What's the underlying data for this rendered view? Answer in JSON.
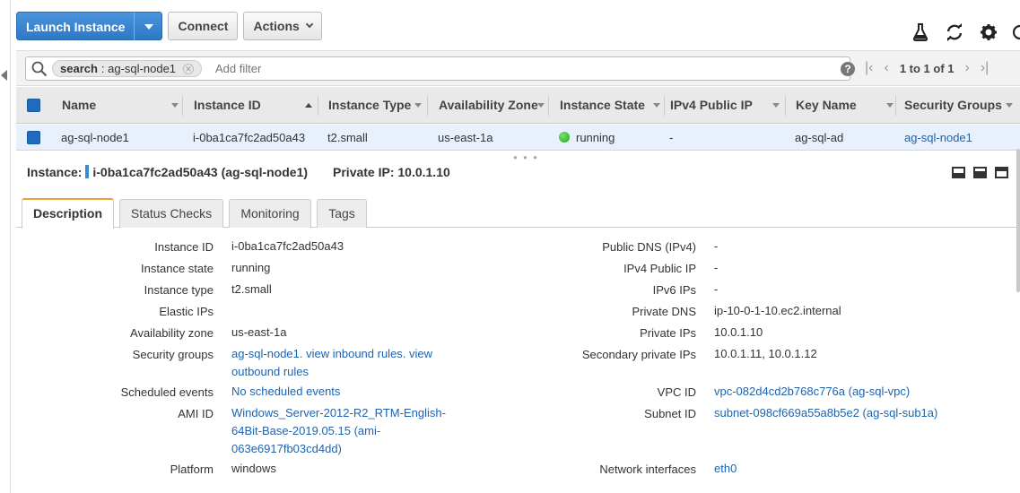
{
  "toolbar": {
    "launch_label": "Launch Instance",
    "connect_label": "Connect",
    "actions_label": "Actions"
  },
  "icons": {
    "flask": "flask-icon",
    "refresh": "refresh-icon",
    "settings": "gear-icon",
    "help": "help-icon"
  },
  "filter": {
    "chip_key": "search",
    "chip_value": ": ag-sql-node1",
    "placeholder": "Add filter",
    "help_label": "?"
  },
  "pager": {
    "count_text": "1 to 1 of 1"
  },
  "table": {
    "headers": [
      "Name",
      "Instance ID",
      "Instance Type",
      "Availability Zone",
      "Instance State",
      "IPv4 Public IP",
      "Key Name",
      "Security Groups"
    ],
    "rows": [
      {
        "name": "ag-sql-node1",
        "instance_id": "i-0ba1ca7fc2ad50a43",
        "instance_type": "t2.small",
        "availability_zone": "us-east-1a",
        "instance_state": "running",
        "ipv4_public_ip": "-",
        "key_name": "ag-sql-ad",
        "security_groups": "ag-sql-node1"
      }
    ]
  },
  "detail": {
    "instance_prefix": "Instance:",
    "instance_text": "i-0ba1ca7fc2ad50a43 (ag-sql-node1)",
    "private_ip_text": "Private IP: 10.0.1.10"
  },
  "tabs": [
    "Description",
    "Status Checks",
    "Monitoring",
    "Tags"
  ],
  "description": {
    "left": [
      {
        "label": "Instance ID",
        "value": "i-0ba1ca7fc2ad50a43"
      },
      {
        "label": "Instance state",
        "value": "running"
      },
      {
        "label": "Instance type",
        "value": "t2.small"
      },
      {
        "label": "Elastic IPs",
        "value": ""
      },
      {
        "label": "Availability zone",
        "value": "us-east-1a"
      },
      {
        "label": "Security groups",
        "value_link_1": "ag-sql-node1.",
        "value_link_2": "view inbound rules.",
        "value_link_3": "view",
        "value_link_4": "outbound rules"
      },
      {
        "label": "Scheduled events",
        "value": "No scheduled events"
      },
      {
        "label": "AMI ID",
        "value_line_1": "Windows_Server-2012-R2_RTM-English-",
        "value_line_2": "64Bit-Base-2019.05.15 (ami-",
        "value_line_3": "063e6917fb03cd4dd)"
      },
      {
        "label": "Platform",
        "value": "windows"
      }
    ],
    "right": [
      {
        "label": "Public DNS (IPv4)",
        "value": "-"
      },
      {
        "label": "IPv4 Public IP",
        "value": "-"
      },
      {
        "label": "IPv6 IPs",
        "value": "-"
      },
      {
        "label": "Private DNS",
        "value": "ip-10-0-1-10.ec2.internal"
      },
      {
        "label": "Private IPs",
        "value": "10.0.1.10"
      },
      {
        "label": "Secondary private IPs",
        "value": "10.0.1.11, 10.0.1.12"
      },
      {
        "label": "VPC ID",
        "value": "vpc-082d4cd2b768c776a (ag-sql-vpc)"
      },
      {
        "label": "Subnet ID",
        "value": "subnet-098cf669a55a8b5e2 (ag-sql-sub1a)"
      },
      {
        "label": "Network interfaces",
        "value": "eth0"
      }
    ]
  },
  "colors": {
    "primary": "#2f78c4",
    "link": "#1d63b0",
    "selected_row": "#e7f0fb",
    "running": "#1fa51a",
    "tab_accent": "#e8a23a"
  }
}
